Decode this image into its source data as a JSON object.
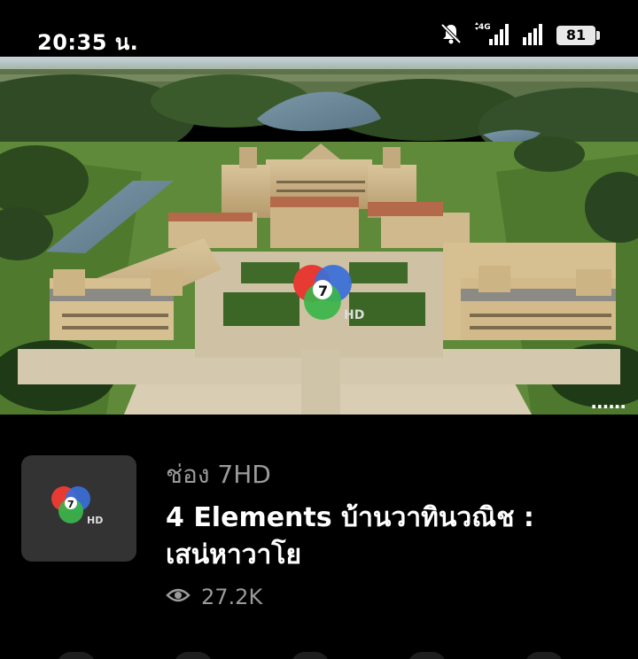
{
  "status_bar": {
    "time": "20:35 น.",
    "icons": [
      "mute-bell-icon",
      "signal-4g-icon",
      "signal-icon"
    ],
    "network_label": "4G",
    "battery": "81"
  },
  "hero": {
    "overlay_logo": "channel-7hd-logo",
    "logo_text": "HD",
    "more_label": "......"
  },
  "video": {
    "channel": "ช่อง 7HD",
    "title": "4 Elements บ้านวาทินวณิช : เสน่หาวาโย",
    "views": "27.2K",
    "views_icon": "eye-icon"
  },
  "colors": {
    "background": "#000000",
    "muted_text": "#9a9a9a",
    "logo_red": "#e63a33",
    "logo_blue": "#3a6fd8",
    "logo_green": "#3bb54a"
  }
}
